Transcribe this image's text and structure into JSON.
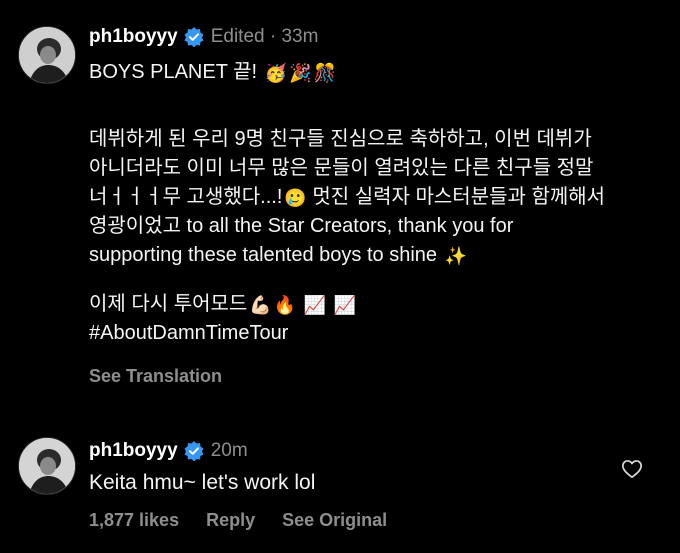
{
  "post": {
    "username": "ph1boyyy",
    "meta": "Edited · 33m",
    "title": "BOYS PLANET 끝!",
    "title_emojis": [
      "🥳",
      "🎉",
      "🎊"
    ],
    "body_lines": [
      "데뷔하게 된 우리 9명 친구들 진심으로 축하하고, 이번 데뷔가",
      "아니더라도 이미 너무 많은 문들이 열려있는 다른 친구들 정말",
      "너ㅓㅓㅓ무 고생했다...!",
      "멋진 실력자 마스터분들과 함께해서",
      "영광이었고 to all the Star Creators, thank you for",
      "supporting these talented boys to shine"
    ],
    "line3_emoji": "🥲",
    "shine_emoji": "✨",
    "tour_line": "이제 다시 투어모드",
    "tour_emojis": [
      "💪🏻",
      "🔥",
      "📈",
      "📈"
    ],
    "hashtag": "#AboutDamnTimeTour",
    "see_translation": "See Translation"
  },
  "reply": {
    "username": "ph1boyyy",
    "meta": "20m",
    "text": "Keita hmu~ let's work lol",
    "likes": "1,877 likes",
    "reply_label": "Reply",
    "see_original": "See Original"
  },
  "colors": {
    "background": "#000000",
    "text": "#f5f5f5",
    "muted": "#8e8e8e",
    "verified": "#3897f0"
  },
  "icons": [
    "verified-badge-icon",
    "heart-icon"
  ]
}
